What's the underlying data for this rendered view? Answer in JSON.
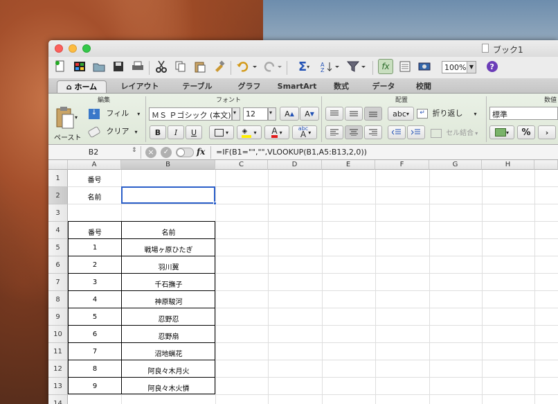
{
  "window": {
    "title": "ブック1"
  },
  "toolbar": {
    "zoom": "100%"
  },
  "tabs": [
    {
      "label": "ホーム"
    },
    {
      "label": "レイアウト"
    },
    {
      "label": "テーブル"
    },
    {
      "label": "グラフ"
    },
    {
      "label": "SmartArt"
    },
    {
      "label": "数式"
    },
    {
      "label": "データ"
    },
    {
      "label": "校閲"
    }
  ],
  "ribbon": {
    "edit_group": "編集",
    "paste": "ペースト",
    "fill": "フィル",
    "clear": "クリア",
    "font_group": "フォント",
    "font_name": "ＭＳ Ｐゴシック (本文)",
    "font_size": "12",
    "bold": "B",
    "italic": "I",
    "underline": "U",
    "align_group": "配置",
    "wrap": "折り返し",
    "merge": "セル結合",
    "abc": "abc",
    "number_group": "数値",
    "number_format": "標準",
    "percent": "%"
  },
  "formula_bar": {
    "name_box": "B2",
    "fx": "fx",
    "formula": "=IF(B1=\"\",\"\",VLOOKUP(B1,A5:B13,2,0))"
  },
  "sheet": {
    "columns": [
      "A",
      "B",
      "C",
      "D",
      "E",
      "F",
      "G",
      "H"
    ],
    "rows": [
      "1",
      "2",
      "3",
      "4",
      "5",
      "6",
      "7",
      "8",
      "9",
      "10",
      "11",
      "12",
      "13",
      "14"
    ],
    "labels": {
      "a1": "番号",
      "a2": "名前"
    },
    "table_header": {
      "col1": "番号",
      "col2": "名前"
    },
    "table_rows": [
      {
        "num": "1",
        "name": "戦場ヶ原ひたぎ"
      },
      {
        "num": "2",
        "name": "羽川翼"
      },
      {
        "num": "3",
        "name": "千石撫子"
      },
      {
        "num": "4",
        "name": "神原駿河"
      },
      {
        "num": "5",
        "name": "忍野忍"
      },
      {
        "num": "6",
        "name": "忍野扇"
      },
      {
        "num": "7",
        "name": "沼地蝋花"
      },
      {
        "num": "8",
        "name": "阿良々木月火"
      },
      {
        "num": "9",
        "name": "阿良々木火憐"
      }
    ]
  }
}
